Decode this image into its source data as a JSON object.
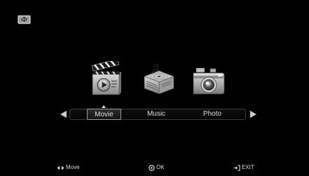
{
  "menu": {
    "items": [
      {
        "label": "Movie",
        "icon": "movie-clapperboard-icon",
        "selected": true
      },
      {
        "label": "Music",
        "icon": "music-cd-player-icon",
        "selected": false
      },
      {
        "label": "Photo",
        "icon": "photo-camera-icon",
        "selected": false
      }
    ]
  },
  "source_icon": "usb-drive-icon",
  "footer": {
    "move_label": "Move",
    "ok_label": "OK",
    "exit_label": "EXIT"
  }
}
